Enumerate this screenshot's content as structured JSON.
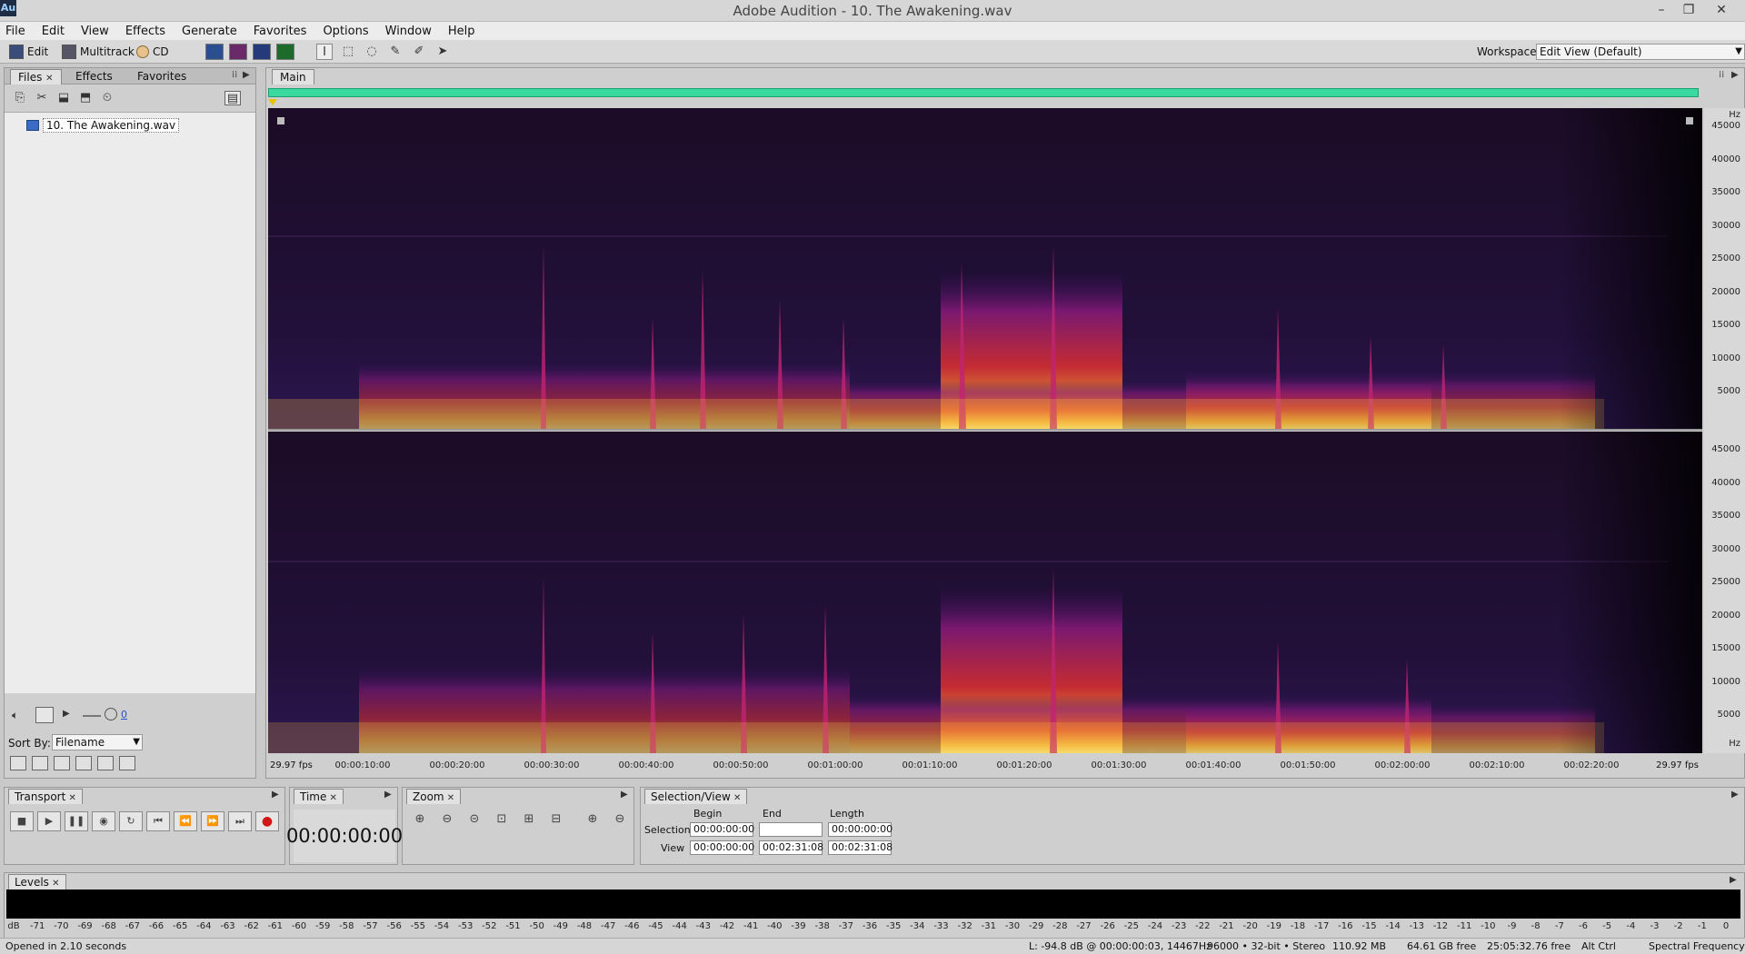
{
  "window": {
    "app_icon": "Au",
    "title": "Adobe Audition - 10. The Awakening.wav",
    "controls": [
      "–",
      "❐",
      "✕"
    ]
  },
  "menu": [
    "File",
    "Edit",
    "View",
    "Effects",
    "Generate",
    "Favorites",
    "Options",
    "Window",
    "Help"
  ],
  "toolbar": {
    "modes": [
      "Edit",
      "Multitrack",
      "CD"
    ],
    "workspace_label": "Workspace:",
    "workspace_value": "Edit View (Default)"
  },
  "files_panel": {
    "tabs": [
      "Files",
      "Effects",
      "Favorites"
    ],
    "file_name": "10. The Awakening.wav",
    "counter": "0",
    "sort_by_label": "Sort By:",
    "sort_by_value": "Filename"
  },
  "main": {
    "tab": "Main",
    "hz_unit": "Hz",
    "hz_labels": [
      "45000",
      "40000",
      "35000",
      "30000",
      "25000",
      "20000",
      "15000",
      "10000",
      "5000"
    ],
    "time_start": "29.97 fps",
    "time_end": "29.97 fps",
    "time_labels": [
      "00:00:10:00",
      "00:00:20:00",
      "00:00:30:00",
      "00:00:40:00",
      "00:00:50:00",
      "00:01:00:00",
      "00:01:10:00",
      "00:01:20:00",
      "00:01:30:00",
      "00:01:40:00",
      "00:01:50:00",
      "00:02:00:00",
      "00:02:10:00",
      "00:02:20:00"
    ]
  },
  "transport": {
    "title": "Transport"
  },
  "time_panel": {
    "title": "Time",
    "display": "00:00:00:00"
  },
  "zoom_panel": {
    "title": "Zoom"
  },
  "selection": {
    "title": "Selection/View",
    "headers": [
      "Begin",
      "End",
      "Length"
    ],
    "selection_label": "Selection",
    "view_label": "View",
    "selection_begin": "00:00:00:00",
    "selection_end": "",
    "selection_length": "00:00:00:00",
    "view_begin": "00:00:00:00",
    "view_end": "00:02:31:08",
    "view_length": "00:02:31:08"
  },
  "levels": {
    "title": "Levels",
    "scale": [
      "dB",
      "-71",
      "-70",
      "-69",
      "-68",
      "-67",
      "-66",
      "-65",
      "-64",
      "-63",
      "-62",
      "-61",
      "-60",
      "-59",
      "-58",
      "-57",
      "-56",
      "-55",
      "-54",
      "-53",
      "-52",
      "-51",
      "-50",
      "-49",
      "-48",
      "-47",
      "-46",
      "-45",
      "-44",
      "-43",
      "-42",
      "-41",
      "-40",
      "-39",
      "-38",
      "-37",
      "-36",
      "-35",
      "-34",
      "-33",
      "-32",
      "-31",
      "-30",
      "-29",
      "-28",
      "-27",
      "-26",
      "-25",
      "-24",
      "-23",
      "-22",
      "-21",
      "-20",
      "-19",
      "-18",
      "-17",
      "-16",
      "-15",
      "-14",
      "-13",
      "-12",
      "-11",
      "-10",
      "-9",
      "-8",
      "-7",
      "-6",
      "-5",
      "-4",
      "-3",
      "-2",
      "-1",
      "0"
    ]
  },
  "status": {
    "left": "Opened in 2.10 seconds",
    "cursor": "L: -94.8 dB @ 00:00:00:03, 14467Hz",
    "format": "96000 • 32-bit • Stereo",
    "size": "110.92 MB",
    "disk": "64.61 GB free",
    "time_free": "25:05:32.76 free",
    "keys": "Alt Ctrl",
    "view_mode": "Spectral Frequency"
  },
  "colors": {
    "spectrogram_bg": "#1a0c24",
    "spectrogram_hot": "#ffd84a",
    "overview": "#39d9a0"
  }
}
